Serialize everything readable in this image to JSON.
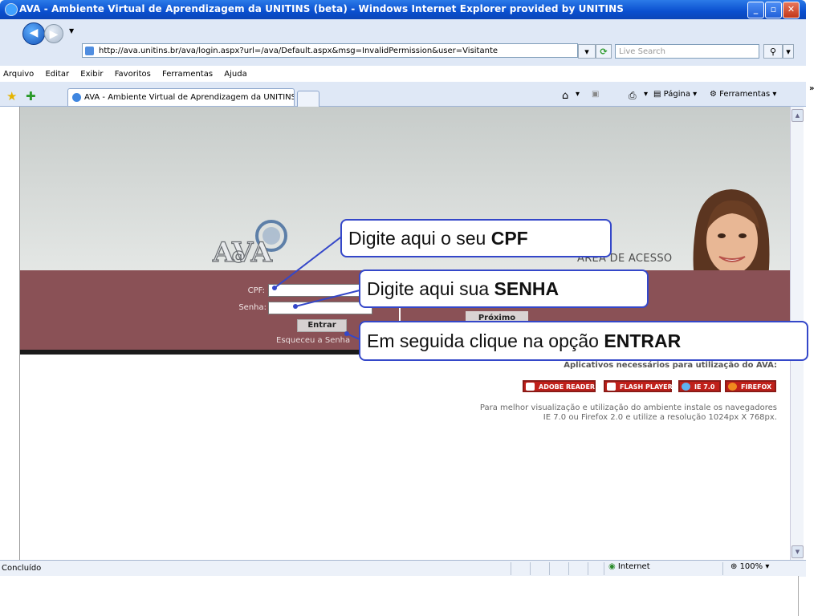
{
  "window": {
    "title": "AVA - Ambiente Virtual de Aprendizagem da UNITINS (beta) - Windows Internet Explorer provided by UNITINS",
    "min": "_",
    "max": "▫",
    "close": "✕"
  },
  "address": {
    "url": "http://ava.unitins.br/ava/login.aspx?url=/ava/Default.aspx&msg=InvalidPermission&user=Visitante",
    "search_placeholder": "Live Search"
  },
  "menu": [
    "Arquivo",
    "Editar",
    "Exibir",
    "Favoritos",
    "Ferramentas",
    "Ajuda"
  ],
  "tab": {
    "label": "AVA - Ambiente Virtual de Aprendizagem da UNITINS ..."
  },
  "toolbar": {
    "pagina": "Página",
    "ferramentas": "Ferramentas",
    "more": "»"
  },
  "login": {
    "area_title": "ÁREA DE ACESSO",
    "cpf_label": "CPF:",
    "senha_label": "Senha:",
    "entrar": "Entrar",
    "esqueceu": "Esqueceu a Senha",
    "proximo": "Próximo",
    "logo_text": "AVA"
  },
  "apps": {
    "title": "Aplicativos necessários para utilização do AVA:",
    "badges": [
      "ADOBE READER",
      "FLASH PLAYER",
      "IE 7.0",
      "FIREFOX"
    ],
    "badge_colors": [
      "#c0201a",
      "#c0201a",
      "#1a62b8",
      "#c0201a"
    ],
    "note_line1": "Para melhor visualização e utilização do ambiente instale os navegadores",
    "note_line2": "IE 7.0 ou Firefox 2.0 e utilize a resolução 1024px X 768px."
  },
  "status": {
    "text": "Concluído",
    "zone": "Internet",
    "zoom": "100%"
  },
  "callouts": {
    "cpf": {
      "text": "Digite aqui o seu ",
      "bold": "CPF"
    },
    "senha": {
      "text": "Digite aqui sua ",
      "bold": "SENHA"
    },
    "entrar": {
      "text": "Em seguida clique na opção ",
      "bold": "ENTRAR"
    }
  },
  "colors": {
    "titlebar": "#0a4fcf",
    "login_band": "#8a5156",
    "callout_border": "#3447c9"
  }
}
